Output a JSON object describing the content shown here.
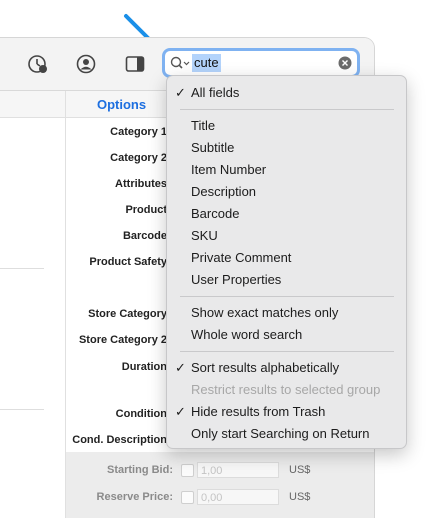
{
  "search": {
    "query": "cute"
  },
  "options_header": "Options",
  "form_labels": [
    "Category 1",
    "Category 2",
    "Attributes",
    "Product",
    "Barcode",
    "Product Safety",
    "Store Category",
    "Store Category 2",
    "Duration",
    "Condition",
    "Cond. Description"
  ],
  "bottom": {
    "starting_bid_label": "Starting Bid:",
    "starting_bid_value": "1,00",
    "reserve_price_label": "Reserve Price:",
    "reserve_price_value": "0,00",
    "currency": "US$"
  },
  "menu": {
    "group1": [
      {
        "label": "All fields",
        "checked": true
      }
    ],
    "group2": [
      {
        "label": "Title"
      },
      {
        "label": "Subtitle"
      },
      {
        "label": "Item Number"
      },
      {
        "label": "Description"
      },
      {
        "label": "Barcode"
      },
      {
        "label": "SKU"
      },
      {
        "label": "Private Comment"
      },
      {
        "label": "User Properties"
      }
    ],
    "group3": [
      {
        "label": "Show exact matches only"
      },
      {
        "label": "Whole word search"
      }
    ],
    "group4": [
      {
        "label": "Sort results alphabetically",
        "checked": true
      },
      {
        "label": "Restrict results to selected group",
        "disabled": true
      },
      {
        "label": "Hide results from Trash",
        "checked": true
      },
      {
        "label": "Only start Searching on Return"
      }
    ]
  },
  "check_glyph": "✓",
  "colors": {
    "accent": "#1d6fe0",
    "arrow": "#1a8fe8",
    "focus_ring": "#7fb2f1",
    "selection": "#b3d3fb"
  }
}
